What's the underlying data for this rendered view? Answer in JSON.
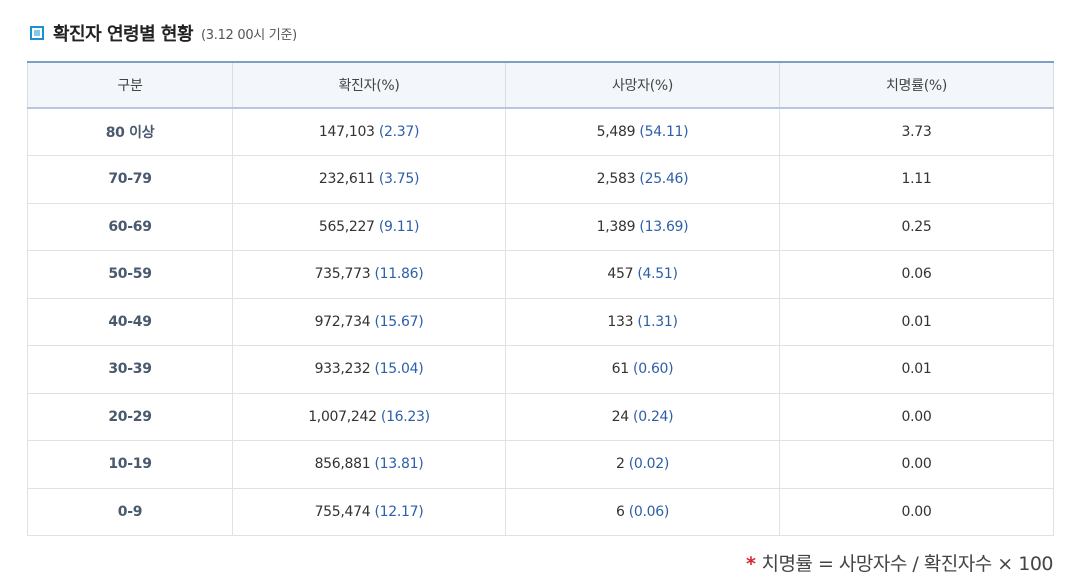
{
  "header": {
    "title": "확진자 연령별 현황",
    "subtitle": "(3.12 00시 기준)"
  },
  "table": {
    "columns": [
      "구분",
      "확진자(%)",
      "사망자(%)",
      "치명률(%)"
    ],
    "rows": [
      {
        "age": "80 이상",
        "confirmed": "147,103",
        "confirmed_pct": "(2.37)",
        "deaths": "5,489",
        "deaths_pct": "(54.11)",
        "fatality": "3.73"
      },
      {
        "age": "70-79",
        "confirmed": "232,611",
        "confirmed_pct": "(3.75)",
        "deaths": "2,583",
        "deaths_pct": "(25.46)",
        "fatality": "1.11"
      },
      {
        "age": "60-69",
        "confirmed": "565,227",
        "confirmed_pct": "(9.11)",
        "deaths": "1,389",
        "deaths_pct": "(13.69)",
        "fatality": "0.25"
      },
      {
        "age": "50-59",
        "confirmed": "735,773",
        "confirmed_pct": "(11.86)",
        "deaths": "457",
        "deaths_pct": "(4.51)",
        "fatality": "0.06"
      },
      {
        "age": "40-49",
        "confirmed": "972,734",
        "confirmed_pct": "(15.67)",
        "deaths": "133",
        "deaths_pct": "(1.31)",
        "fatality": "0.01"
      },
      {
        "age": "30-39",
        "confirmed": "933,232",
        "confirmed_pct": "(15.04)",
        "deaths": "61",
        "deaths_pct": "(0.60)",
        "fatality": "0.01"
      },
      {
        "age": "20-29",
        "confirmed": "1,007,242",
        "confirmed_pct": "(16.23)",
        "deaths": "24",
        "deaths_pct": "(0.24)",
        "fatality": "0.00"
      },
      {
        "age": "10-19",
        "confirmed": "856,881",
        "confirmed_pct": "(13.81)",
        "deaths": "2",
        "deaths_pct": "(0.02)",
        "fatality": "0.00"
      },
      {
        "age": "0-9",
        "confirmed": "755,474",
        "confirmed_pct": "(12.17)",
        "deaths": "6",
        "deaths_pct": "(0.06)",
        "fatality": "0.00"
      }
    ]
  },
  "footnote": {
    "marker": "*",
    "text": "치명률 = 사망자수 / 확진자수 × 100"
  },
  "colors": {
    "accent": "#1e8fd0",
    "value_blue": "#2d5fa8",
    "footnote_star": "#d7242e"
  }
}
